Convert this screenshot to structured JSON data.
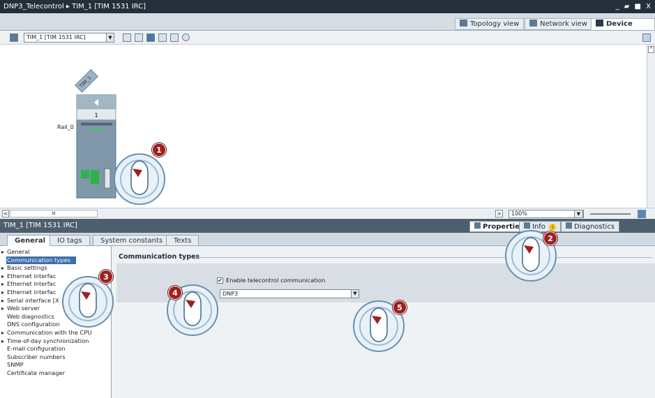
{
  "title": "DNP3_Telecontrol ▸ TIM_1 [TIM 1531 IRC]",
  "window_controls": "_ ▰ ■ X",
  "view_tabs": [
    {
      "label": "Topology view",
      "icon": "topology-icon"
    },
    {
      "label": "Network view",
      "icon": "network-icon"
    },
    {
      "label": "Device view",
      "icon": "device-icon",
      "active": true
    }
  ],
  "toolbar": {
    "device_select": "TIM_1 [TIM 1531 IRC]"
  },
  "device": {
    "name": "TIM_1",
    "rail": "Rail_0",
    "slot": "1"
  },
  "zoom": "100%",
  "scroll_marker": "III",
  "panel": {
    "title": "TIM_1 [TIM 1531 IRC]",
    "tabs": [
      {
        "label": "Properties",
        "icon": "properties-icon",
        "active": true
      },
      {
        "label": "Info",
        "icon": "info-icon"
      },
      {
        "label": "Diagnostics",
        "icon": "diagnostics-icon"
      }
    ],
    "info_badge": "i"
  },
  "subtabs": [
    {
      "label": "General",
      "active": true
    },
    {
      "label": "IO tags"
    },
    {
      "label": "System constants"
    },
    {
      "label": "Texts"
    }
  ],
  "nav": [
    {
      "label": "General",
      "parent": true
    },
    {
      "label": "Communication types",
      "selected": true
    },
    {
      "label": "Basic settings",
      "parent": true
    },
    {
      "label": "Ethernet interfac",
      "parent": true
    },
    {
      "label": "Ethernet interfac",
      "parent": true
    },
    {
      "label": "Ethernet interfac",
      "parent": true
    },
    {
      "label": "Serial interface [X",
      "parent": true
    },
    {
      "label": "Web server",
      "parent": true
    },
    {
      "label": "Web diagnostics"
    },
    {
      "label": "DNS configuration"
    },
    {
      "label": "Communication with the CPU",
      "parent": true
    },
    {
      "label": "Time-of-day synchronization",
      "parent": true
    },
    {
      "label": "E-mail configuration"
    },
    {
      "label": "Subscriber numbers"
    },
    {
      "label": "SNMP"
    },
    {
      "label": "Certificate manager"
    }
  ],
  "content": {
    "section_title": "Communication types",
    "checkbox_label": "Enable telecontrol communication",
    "checkbox_checked": true,
    "protocol": "DNP3"
  },
  "callouts": [
    "1",
    "2",
    "3",
    "4",
    "5"
  ],
  "colors": {
    "titlebar": "#23303c",
    "panelhead": "#4d5f6e",
    "selection": "#3d6ea8",
    "badge": "#9d2020",
    "module": "#7f97a8"
  }
}
